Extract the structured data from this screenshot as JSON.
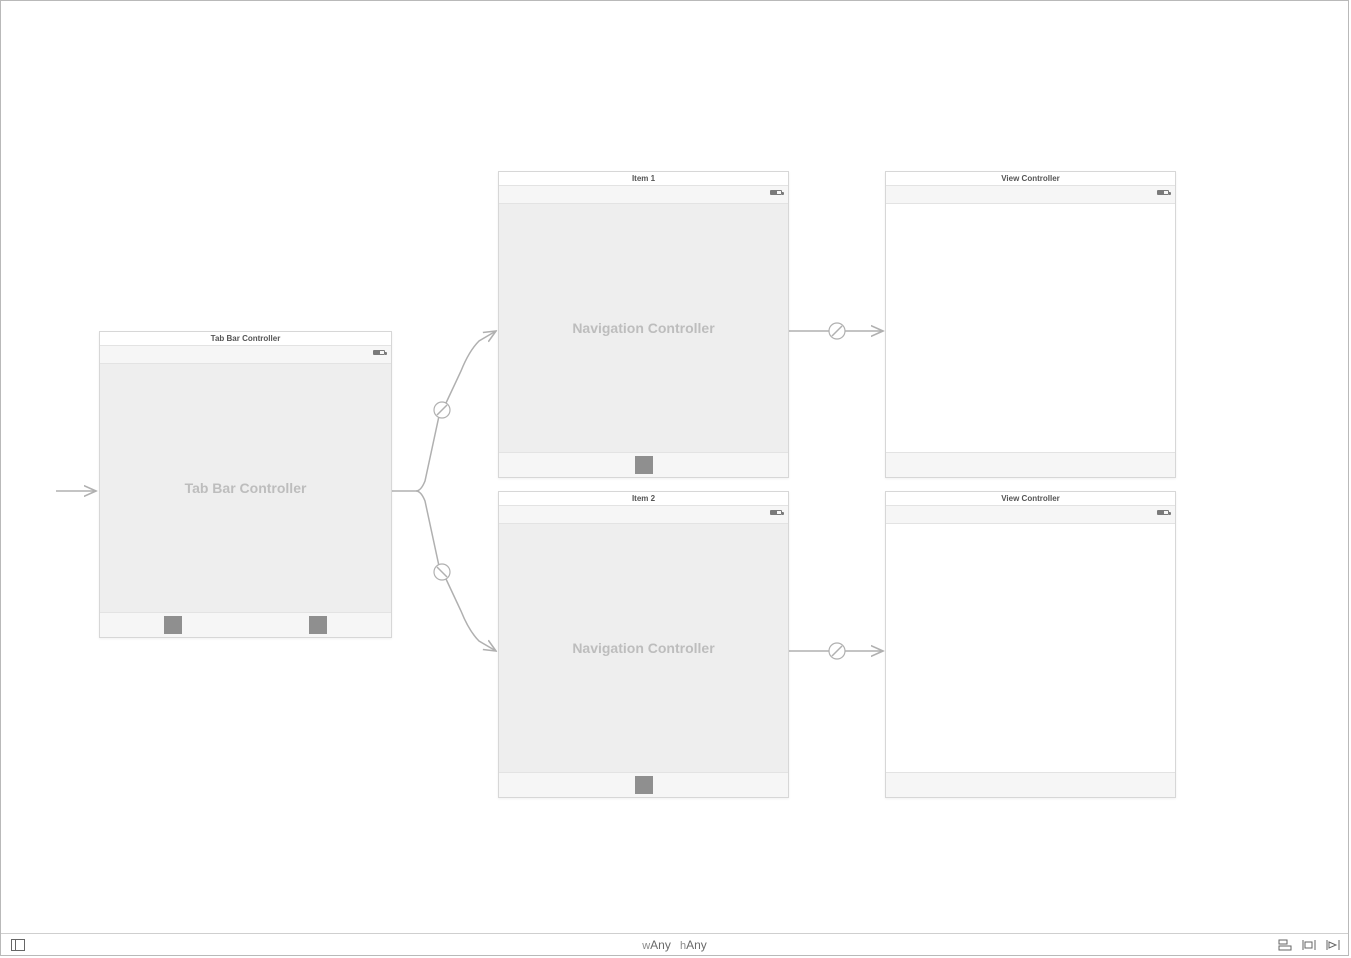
{
  "scenes": {
    "tabbar": {
      "title": "Tab Bar Controller",
      "placeholder": "Tab Bar Controller"
    },
    "nav1": {
      "title": "Item 1",
      "placeholder": "Navigation Controller"
    },
    "nav2": {
      "title": "Item 2",
      "placeholder": "Navigation Controller"
    },
    "vc1": {
      "title": "View Controller"
    },
    "vc2": {
      "title": "View Controller"
    }
  },
  "footer": {
    "size_w_prefix": "w",
    "size_w_value": "Any",
    "size_h_prefix": "h",
    "size_h_value": "Any"
  }
}
